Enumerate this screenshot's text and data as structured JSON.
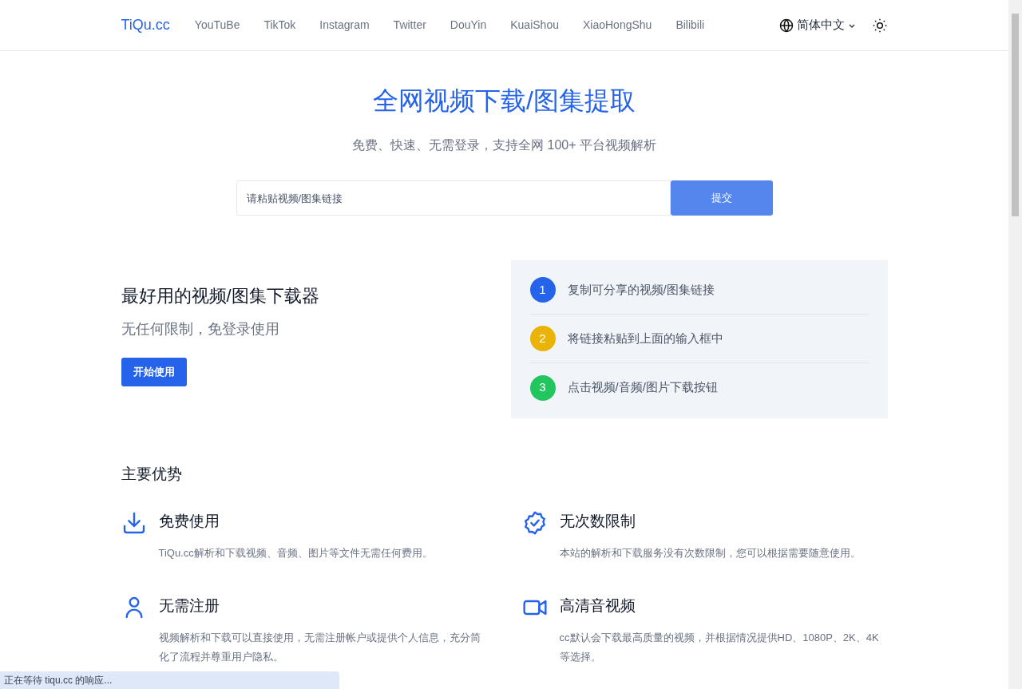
{
  "header": {
    "logo": "TiQu.cc",
    "nav": [
      {
        "label": "YouTuBe"
      },
      {
        "label": "TikTok"
      },
      {
        "label": "Instagram"
      },
      {
        "label": "Twitter"
      },
      {
        "label": "DouYin"
      },
      {
        "label": "KuaiShou"
      },
      {
        "label": "XiaoHongShu"
      },
      {
        "label": "Bilibili"
      }
    ],
    "language": "简体中文"
  },
  "hero": {
    "title": "全网视频下载/图集提取",
    "subtitle": "免费、快速、无需登录，支持全网 100+ 平台视频解析",
    "input": {
      "placeholder": "请粘贴视频/图集链接"
    },
    "submit": "提交"
  },
  "intro": {
    "title": "最好用的视频/图集下载器",
    "subtitle": "无任何限制，免登录使用",
    "button": "开始使用",
    "steps": [
      {
        "number": "1",
        "text": "复制可分享的视频/图集链接",
        "color": "#2563eb"
      },
      {
        "number": "2",
        "text": "将链接粘贴到上面的输入框中",
        "color": "#eab308"
      },
      {
        "number": "3",
        "text": "点击视频/音频/图片下载按钮",
        "color": "#22c55e"
      }
    ]
  },
  "features": {
    "title": "主要优势",
    "items": [
      {
        "kind": "download",
        "title": "免费使用",
        "description": "TiQu.cc解析和下载视频、音频、图片等文件无需任何费用。"
      },
      {
        "kind": "badge",
        "title": "无次数限制",
        "description": "本站的解析和下载服务没有次数限制，您可以根据需要随意使用。"
      },
      {
        "kind": "user",
        "title": "无需注册",
        "description": "视频解析和下载可以直接使用，无需注册帐户或提供个人信息，充分简化了流程并尊重用户隐私。"
      },
      {
        "kind": "video",
        "title": "高清音视频",
        "description": "cc默认会下载最高质量的视频，并根据情况提供HD、1080P、2K、4K等选择。"
      }
    ]
  },
  "status_bar": "正在等待 tiqu.cc 的响应..."
}
